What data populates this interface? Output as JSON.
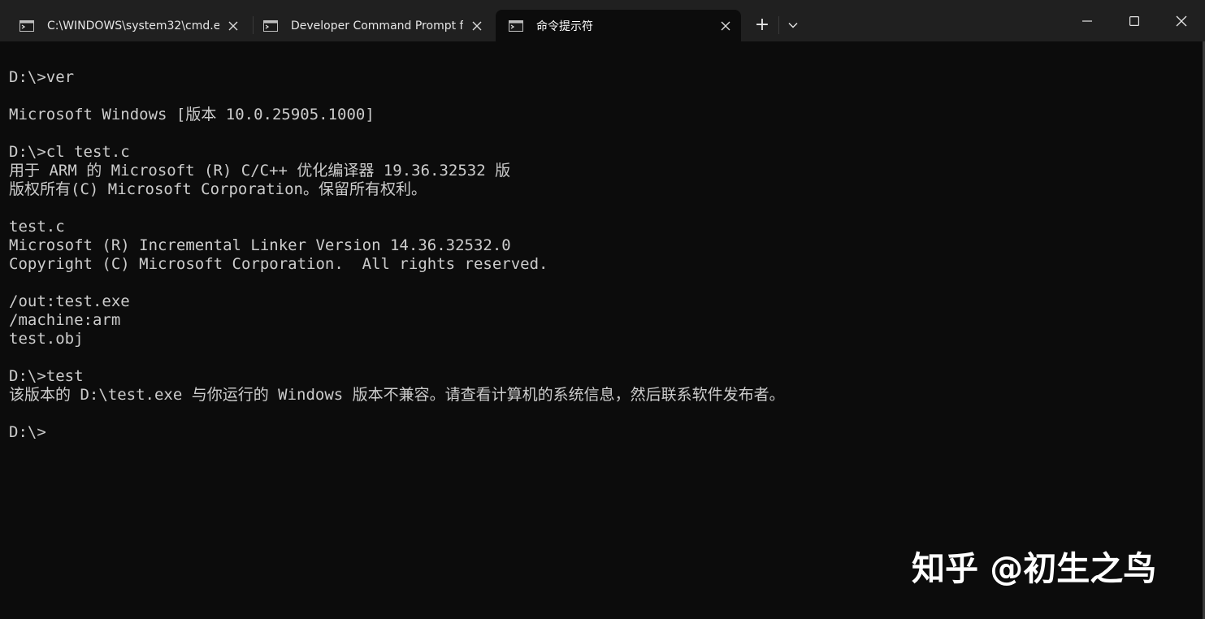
{
  "tabs": [
    {
      "title": "C:\\WINDOWS\\system32\\cmd.e:",
      "icon": "terminal-icon",
      "active": false
    },
    {
      "title": "Developer Command Prompt fo",
      "icon": "terminal-icon",
      "active": false
    },
    {
      "title": "命令提示符",
      "icon": "terminal-icon",
      "active": true
    }
  ],
  "titlebar": {
    "new_tab_glyph": "+",
    "dropdown_icon": "chevron-down-icon"
  },
  "window_controls": [
    "minimize-icon",
    "maximize-icon",
    "close-icon"
  ],
  "terminal": {
    "lines": [
      "D:\\>ver",
      "",
      "Microsoft Windows [版本 10.0.25905.1000]",
      "",
      "D:\\>cl test.c",
      "用于 ARM 的 Microsoft (R) C/C++ 优化编译器 19.36.32532 版",
      "版权所有(C) Microsoft Corporation。保留所有权利。",
      "",
      "test.c",
      "Microsoft (R) Incremental Linker Version 14.36.32532.0",
      "Copyright (C) Microsoft Corporation.  All rights reserved.",
      "",
      "/out:test.exe",
      "/machine:arm",
      "test.obj",
      "",
      "D:\\>test",
      "该版本的 D:\\test.exe 与你运行的 Windows 版本不兼容。请查看计算机的系统信息，然后联系软件发布者。",
      "",
      "D:\\>"
    ]
  },
  "watermark": "知乎 @初生之鸟",
  "colors": {
    "titlebar": "#202020",
    "terminal_bg": "#0c0c0c",
    "terminal_text": "#cccccc"
  }
}
